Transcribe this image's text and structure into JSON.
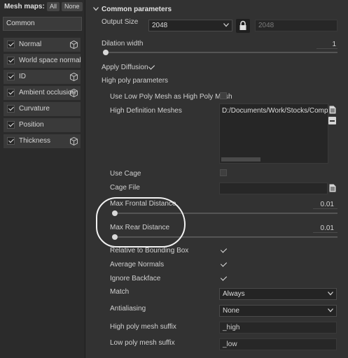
{
  "left_panel": {
    "title": "Mesh maps:",
    "all_label": "All",
    "none_label": "None",
    "preset": "Common",
    "maps": [
      {
        "label": "Normal",
        "checked": true,
        "has_icon": true
      },
      {
        "label": "World space normal",
        "checked": true,
        "has_icon": false
      },
      {
        "label": "ID",
        "checked": true,
        "has_icon": true
      },
      {
        "label": "Ambient occlusion",
        "checked": true,
        "has_icon": true
      },
      {
        "label": "Curvature",
        "checked": true,
        "has_icon": false
      },
      {
        "label": "Position",
        "checked": true,
        "has_icon": false
      },
      {
        "label": "Thickness",
        "checked": true,
        "has_icon": true
      }
    ]
  },
  "common": {
    "section_title": "Common parameters",
    "output_size_label": "Output Size",
    "output_size_value": "2048",
    "output_size_linked_value": "2048",
    "dilation_label": "Dilation width",
    "dilation_value": "1",
    "apply_diffusion_label": "Apply Diffusion",
    "apply_diffusion_checked": true,
    "high_poly_title": "High poly parameters",
    "use_low_poly_label": "Use Low Poly Mesh as High Poly Mesh",
    "use_low_poly_checked": false,
    "high_def_label": "High Definition Meshes",
    "high_def_path": "D:/Documents/Work/Stocks/Compl",
    "use_cage_label": "Use Cage",
    "use_cage_checked": false,
    "cage_file_label": "Cage File",
    "cage_file_value": "",
    "max_frontal_label": "Max Frontal Distance",
    "max_frontal_value": "0.01",
    "max_rear_label": "Max Rear Distance",
    "max_rear_value": "0.01",
    "relative_label": "Relative to Bounding Box",
    "relative_checked": true,
    "average_normals_label": "Average Normals",
    "average_normals_checked": true,
    "ignore_backface_label": "Ignore Backface",
    "ignore_backface_checked": true,
    "match_label": "Match",
    "match_value": "Always",
    "antialiasing_label": "Antialiasing",
    "antialiasing_value": "None",
    "high_suffix_label": "High poly mesh suffix",
    "high_suffix_value": "_high",
    "low_suffix_label": "Low poly mesh suffix",
    "low_suffix_value": "_low"
  },
  "colors": {
    "panel_bg": "#323232",
    "left_bg": "#2b2b2b",
    "highlight_circle": "#f2f2f2"
  }
}
